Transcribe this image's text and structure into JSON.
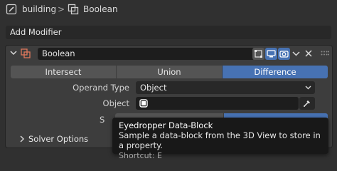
{
  "breadcrumb": {
    "object_name": "building",
    "separator": ">",
    "modifier_name": "Boolean"
  },
  "add_modifier": {
    "label": "Add Modifier"
  },
  "modifier_panel": {
    "name_value": "Boolean",
    "operations": [
      {
        "label": "Intersect",
        "active": false
      },
      {
        "label": "Union",
        "active": false
      },
      {
        "label": "Difference",
        "active": true
      }
    ],
    "operand_type_label": "Operand Type",
    "operand_type_value": "Object",
    "object_label": "Object",
    "object_value": "",
    "solver_label_partial": "S",
    "solver_options_label": "Solver Options"
  },
  "tooltip": {
    "title": "Eyedropper Data-Block",
    "description": "Sample a data-block from the 3D View to store in a property.",
    "shortcut": "Shortcut: E"
  },
  "colors": {
    "accent": "#4772b3",
    "modifier_icon": "#e0785c",
    "background": "#303030"
  },
  "icons": [
    "wrench-icon",
    "boolean-modifier-icon",
    "chevron-down-icon",
    "edit-mode-icon",
    "realtime-icon",
    "render-icon",
    "close-icon",
    "drag-handle-icon",
    "cube-icon",
    "eyedropper-icon",
    "chevron-right-icon"
  ]
}
